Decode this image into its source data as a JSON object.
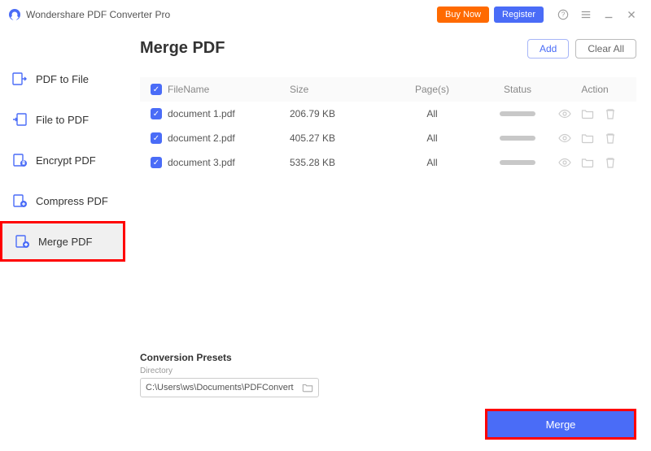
{
  "app": {
    "title": "Wondershare PDF Converter Pro"
  },
  "titlebar": {
    "buy": "Buy Now",
    "register": "Register"
  },
  "sidebar": {
    "items": [
      {
        "label": "PDF to File"
      },
      {
        "label": "File to PDF"
      },
      {
        "label": "Encrypt PDF"
      },
      {
        "label": "Compress PDF"
      },
      {
        "label": "Merge PDF"
      }
    ],
    "active_index": 4
  },
  "page": {
    "title": "Merge PDF",
    "add": "Add",
    "clear_all": "Clear All"
  },
  "table": {
    "headers": {
      "filename": "FileName",
      "size": "Size",
      "pages": "Page(s)",
      "status": "Status",
      "action": "Action"
    },
    "rows": [
      {
        "name": "document 1.pdf",
        "size": "206.79 KB",
        "pages": "All"
      },
      {
        "name": "document 2.pdf",
        "size": "405.27 KB",
        "pages": "All"
      },
      {
        "name": "document 3.pdf",
        "size": "535.28 KB",
        "pages": "All"
      }
    ]
  },
  "presets": {
    "title": "Conversion Presets",
    "directory_label": "Directory",
    "directory_value": "C:\\Users\\ws\\Documents\\PDFConvert"
  },
  "merge": {
    "label": "Merge"
  }
}
